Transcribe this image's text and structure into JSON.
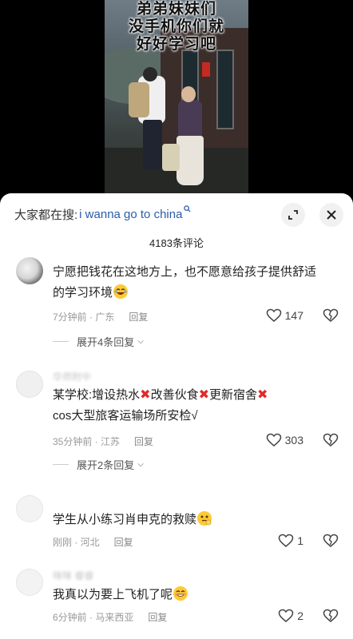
{
  "video": {
    "caption_lines": [
      "弟弟妹妹们",
      "没手机你们就",
      "好好学习吧"
    ]
  },
  "search": {
    "prefix": "大家都在搜:",
    "term": "i wanna go to china",
    "icon": "search-icon"
  },
  "toolbar": {
    "expand_icon": "expand-icon",
    "close_icon": "close-icon"
  },
  "comments_count": "4183条评论",
  "comments": [
    {
      "username": "",
      "text_line1": "宁愿把钱花在这地方上，也不愿意给孩子提供舒适",
      "text_line2": "的学习环境",
      "emoji": "laughing-tears",
      "time_location": "7分钟前 · 广东",
      "reply_label": "回复",
      "likes": "147",
      "expand_label": "展开4条回复"
    },
    {
      "username": "华师附中",
      "text_line1_parts": [
        "某学校:增设热水",
        "改善伙食",
        "更新宿舍"
      ],
      "text_line2": "cos大型旅客运输场所安检√",
      "time_location": "35分钟前 · 江苏",
      "reply_label": "回复",
      "likes": "303",
      "expand_label": "展开2条回复"
    },
    {
      "username": "",
      "text_line1": "学生从小练习肖申克的救赎",
      "emoji": "thinking",
      "time_location": "刚刚 · 河北",
      "reply_label": "回复",
      "likes": "1"
    },
    {
      "username": "咪咪 睿睿",
      "text_line1": "我真以为要上飞机了呢",
      "emoji": "grin",
      "time_location": "6分钟前 · 马来西亚",
      "reply_label": "回复",
      "likes": "2"
    }
  ],
  "colors": {
    "link": "#2a5da8",
    "x_mark": "#e02a2a",
    "meta": "#999999"
  }
}
